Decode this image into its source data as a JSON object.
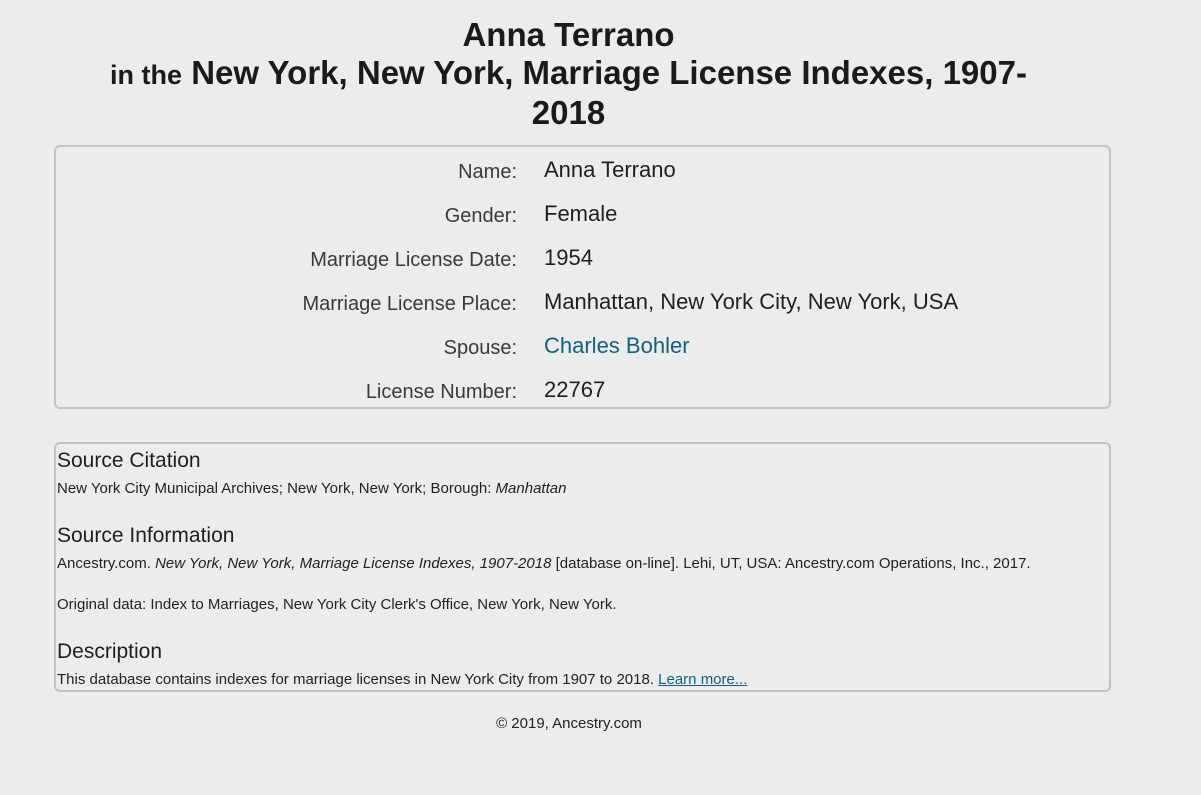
{
  "header": {
    "name": "Anna Terrano",
    "prefix": "in the",
    "collection": "New York, New York, Marriage License Indexes, 1907-",
    "collection_end": "2018"
  },
  "record": {
    "rows": [
      {
        "label": "Name:",
        "value": "Anna Terrano"
      },
      {
        "label": "Gender:",
        "value": "Female"
      },
      {
        "label": "Marriage License Date:",
        "value": "1954"
      },
      {
        "label": "Marriage License Place:",
        "value": "Manhattan, New York City, New York, USA"
      },
      {
        "label": "Spouse:",
        "value": "Charles Bohler"
      },
      {
        "label": "License Number:",
        "value": "22767"
      }
    ]
  },
  "source": {
    "citation_heading": "Source Citation",
    "citation_text": "New York City Municipal Archives; New York, New York; Borough: ",
    "citation_borough": "Manhattan",
    "info_heading": "Source Information",
    "info_prefix": "Ancestry.com. ",
    "info_title": "New York, New York, Marriage License Indexes, 1907-2018",
    "info_suffix": " [database on-line]. Lehi, UT, USA: Ancestry.com Operations, Inc., 2017.",
    "original_data": "Original data: Index to Marriages, New York City Clerk's Office, New York, New York.",
    "description_heading": "Description",
    "description_text": "This database contains indexes for marriage licenses in New York City from 1907 to 2018. ",
    "learn_more": "Learn more..."
  },
  "footer": {
    "copyright": "© 2019, Ancestry.com"
  },
  "colors": {
    "background": "#ececec",
    "link": "#14607a",
    "border": "#c3c3c3"
  }
}
